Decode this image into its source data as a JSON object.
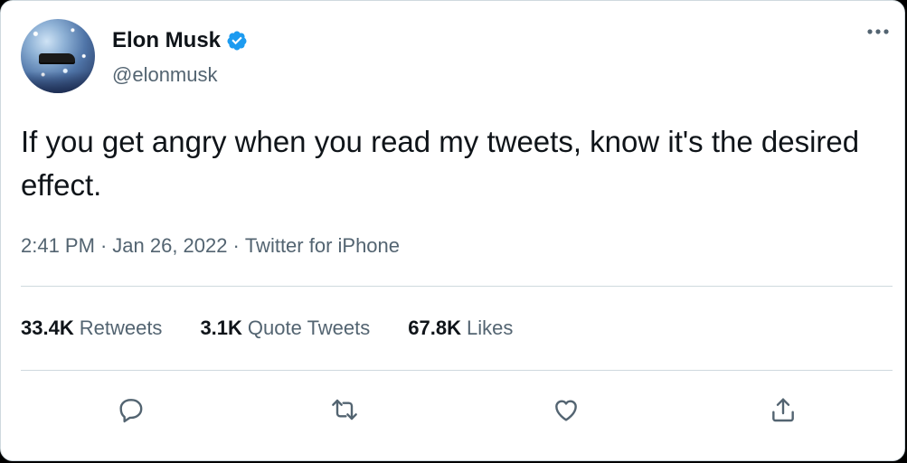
{
  "tweet": {
    "author": {
      "name": "Elon Musk",
      "handle": "@elonmusk",
      "verified_icon": "verified-badge-icon",
      "avatar_icon": "avatar-image"
    },
    "text": "If you get angry when you read my tweets, know it's the desired effect.",
    "time": "2:41 PM",
    "separator": "·",
    "date": "Jan 26, 2022",
    "source": "Twitter for iPhone",
    "stats": [
      {
        "value": "33.4K",
        "label": "Retweets"
      },
      {
        "value": "3.1K",
        "label": "Quote Tweets"
      },
      {
        "value": "67.8K",
        "label": "Likes"
      }
    ],
    "actions": [
      "reply-icon",
      "retweet-icon",
      "like-icon",
      "share-icon"
    ],
    "more_icon": "more-options-icon"
  },
  "colors": {
    "text_primary": "#0f1419",
    "text_secondary": "#536471",
    "verified": "#1d9bf0",
    "divider": "#cfd9de",
    "background": "#ffffff"
  }
}
